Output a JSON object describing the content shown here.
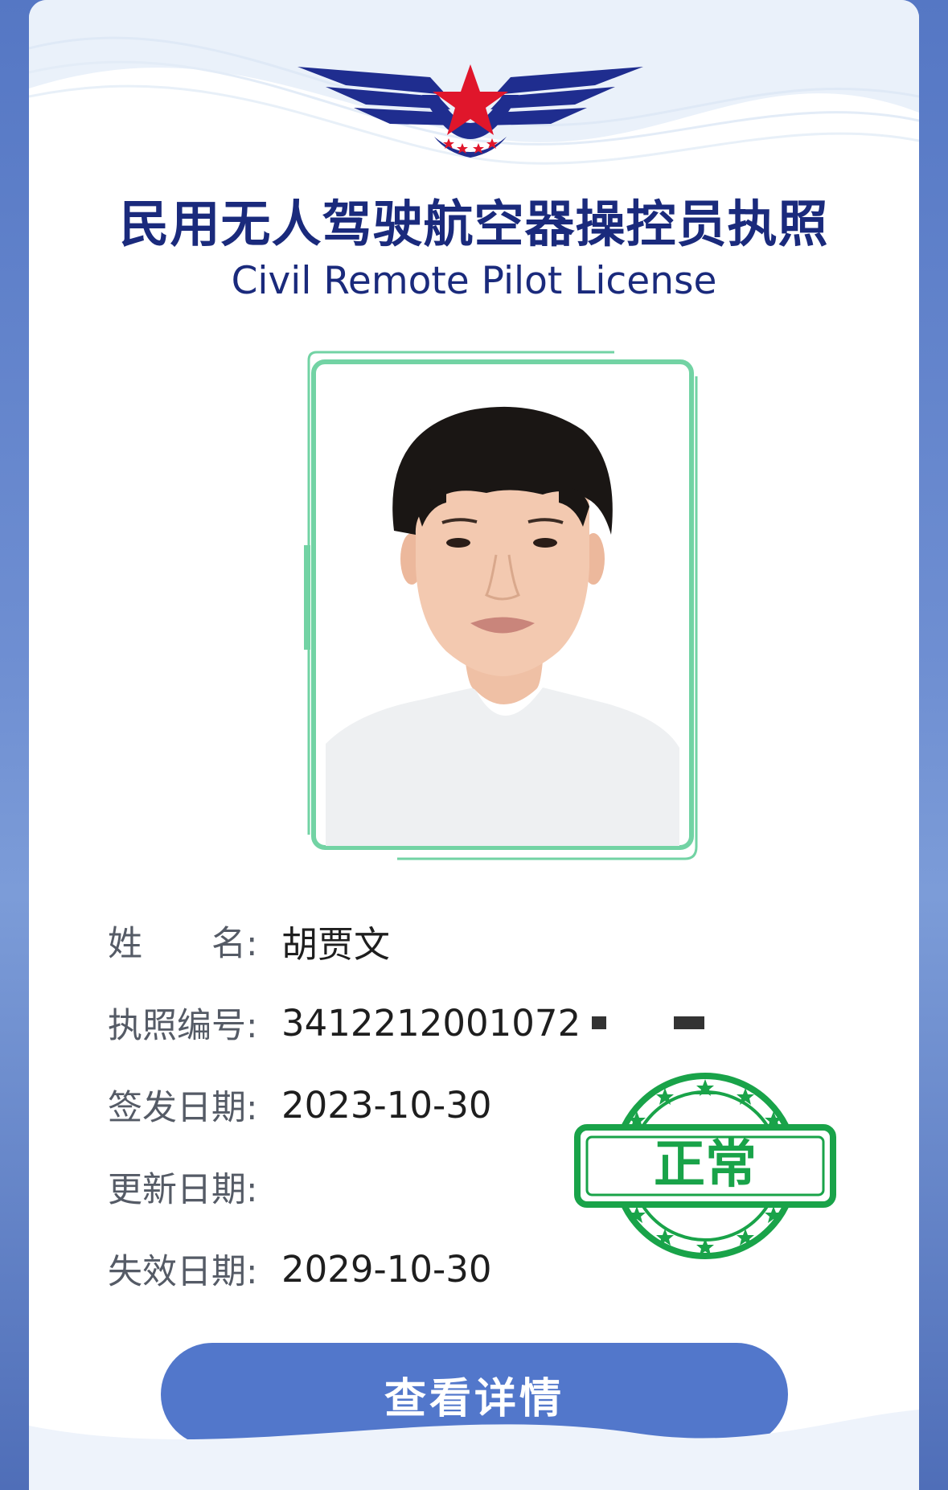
{
  "license": {
    "title_cn": "民用无人驾驶航空器操控员执照",
    "title_en": "Civil Remote Pilot License"
  },
  "fields": [
    {
      "label": "姓　　名:",
      "value": "胡贾文"
    },
    {
      "label": "执照编号:",
      "value": "3412212001072"
    },
    {
      "label": "签发日期:",
      "value": "2023-10-30"
    },
    {
      "label": "更新日期:",
      "value": ""
    },
    {
      "label": "失效日期:",
      "value": "2029-10-30"
    }
  ],
  "stamp": {
    "text": "正常",
    "color": "#19a349"
  },
  "actions": {
    "details_label": "查看详情"
  },
  "colors": {
    "title": "#1a2a7c",
    "button": "#5277cb",
    "photo_frame": "#72d3a4",
    "emblem_blue": "#1f2d8f",
    "emblem_red": "#e0162b"
  },
  "icons": {
    "emblem": "winged-star-emblem",
    "stamp": "status-stamp"
  }
}
